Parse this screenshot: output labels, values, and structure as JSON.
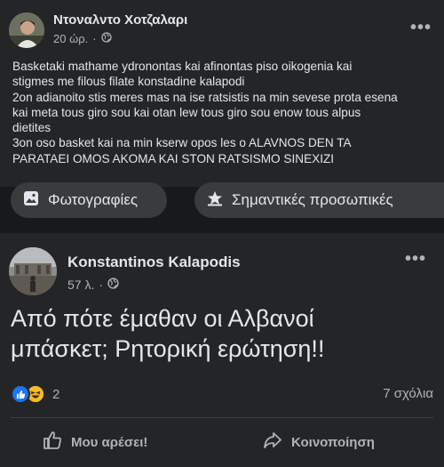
{
  "post1": {
    "author": "Ντοναλντο Χοτζαλαρι",
    "time": "20 ώρ.",
    "more_icon": "more-horizontal-icon",
    "lines": [
      "Basketaki mathame ydronontas kai afinontas piso oikogenia kai",
      "stigmes me filous filate konstadine kalapodi",
      "2on adianoito stis meres mas na ise ratsistis na min sevese prota esena",
      "kai meta tous giro sou kai otan lew tous giro sou enow tous alpus",
      "dietites",
      "3on oso basket kai na min kserw opos les o ALAVNOS DEN TA",
      "PARATAEI OMOS AKOMA KAI STON RATSISMO SINEXIZI"
    ]
  },
  "chips": {
    "photos": "Φωτογραφίες",
    "highlights": "Σημαντικές προσωπικές"
  },
  "post2": {
    "author": "Konstantinos Kalapodis",
    "time": "57 λ.",
    "text_line1": "Από πότε έμαθαν οι Αλβανοί",
    "text_line2": "μπάσκετ; Ρητορική ερώτηση!!",
    "reaction_count": "2",
    "comments": "7 σχόλια",
    "like_label": "Μου αρέσει!",
    "share_label": "Κοινοποίηση"
  },
  "colors": {
    "background": "#18191a",
    "card": "#242526",
    "text": "#e4e6eb",
    "secondary_text": "#b0b3b8",
    "like_blue": "#1877f2",
    "haha_yellow": "#f7b928"
  }
}
